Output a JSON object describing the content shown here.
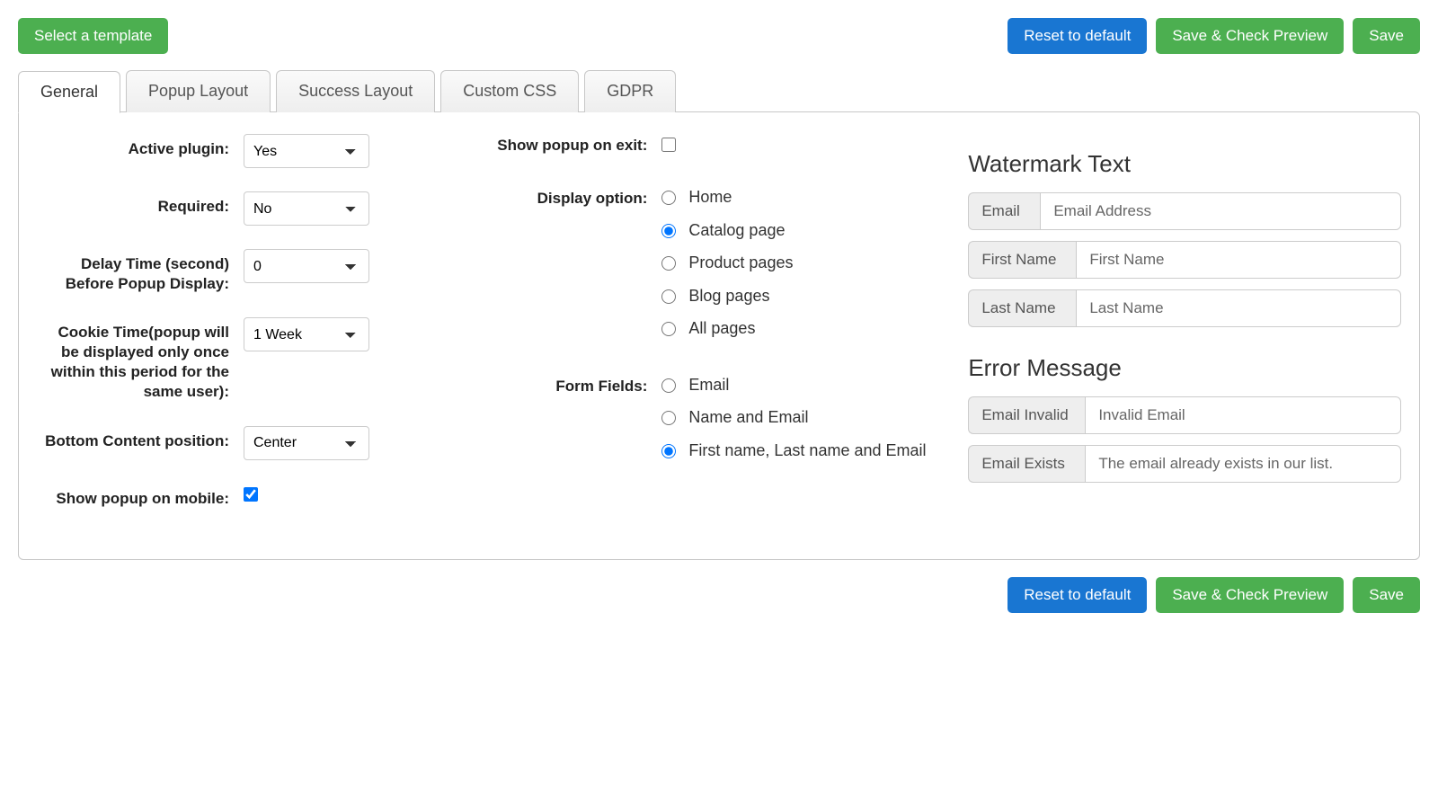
{
  "toolbar": {
    "select_template": "Select a template",
    "reset": "Reset to default",
    "save_preview": "Save & Check Preview",
    "save": "Save"
  },
  "tabs": {
    "general": "General",
    "popup_layout": "Popup Layout",
    "success_layout": "Success Layout",
    "custom_css": "Custom CSS",
    "gdpr": "GDPR"
  },
  "left": {
    "active_plugin": {
      "label": "Active plugin:",
      "value": "Yes"
    },
    "required": {
      "label": "Required:",
      "value": "No"
    },
    "delay_time": {
      "label": "Delay Time (second) Before Popup Display:",
      "value": "0"
    },
    "cookie_time": {
      "label": "Cookie Time(popup will be displayed only once within this period for the same user):",
      "value": "1 Week"
    },
    "bottom_content": {
      "label": "Bottom Content position:",
      "value": "Center"
    },
    "show_mobile": {
      "label": "Show popup on mobile:",
      "checked": true
    }
  },
  "middle": {
    "show_on_exit": {
      "label": "Show popup on exit:",
      "checked": false
    },
    "display_option": {
      "label": "Display option:",
      "options": [
        {
          "text": "Home",
          "checked": false
        },
        {
          "text": "Catalog page",
          "checked": true
        },
        {
          "text": "Product pages",
          "checked": false
        },
        {
          "text": "Blog pages",
          "checked": false
        },
        {
          "text": "All pages",
          "checked": false
        }
      ]
    },
    "form_fields": {
      "label": "Form Fields:",
      "options": [
        {
          "text": "Email",
          "checked": false
        },
        {
          "text": "Name and Email",
          "checked": false
        },
        {
          "text": "First name, Last name and Email",
          "checked": true
        }
      ]
    }
  },
  "right": {
    "watermark": {
      "heading": "Watermark Text",
      "rows": [
        {
          "addon": "Email",
          "value": "Email Address"
        },
        {
          "addon": "First Name",
          "value": "First Name"
        },
        {
          "addon": "Last Name",
          "value": "Last Name"
        }
      ]
    },
    "error": {
      "heading": "Error Message",
      "rows": [
        {
          "addon": "Email Invalid",
          "value": "Invalid Email"
        },
        {
          "addon": "Email Exists",
          "value": "The email already exists in our list."
        }
      ]
    }
  }
}
